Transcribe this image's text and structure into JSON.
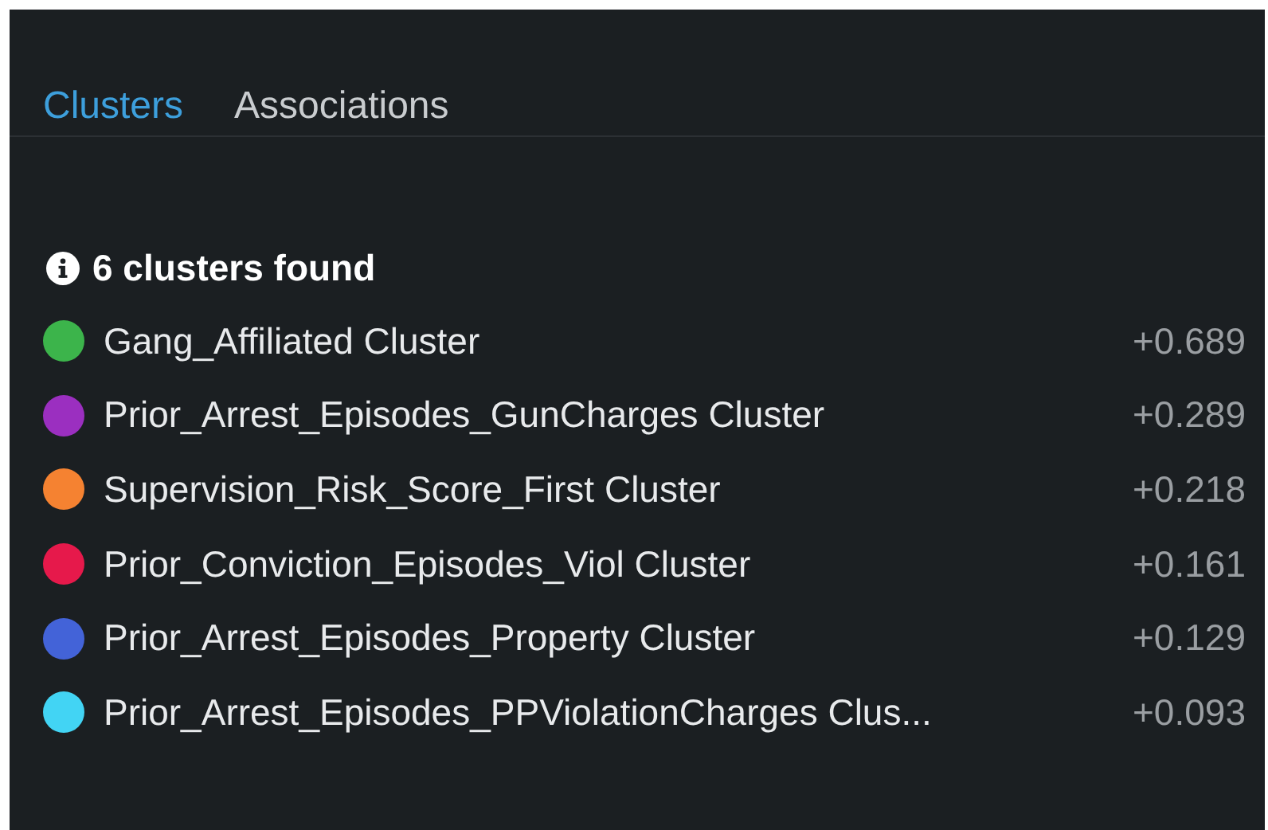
{
  "tabs": [
    {
      "label": "Clusters",
      "selected": true
    },
    {
      "label": "Associations",
      "selected": false
    }
  ],
  "summary": "6 clusters found",
  "clusters": [
    {
      "name": "Gang_Affiliated Cluster",
      "value": "+0.689",
      "color": "#3cb44b"
    },
    {
      "name": "Prior_Arrest_Episodes_GunCharges Cluster",
      "value": "+0.289",
      "color": "#9b2fc0"
    },
    {
      "name": "Supervision_Risk_Score_First Cluster",
      "value": "+0.218",
      "color": "#f58231"
    },
    {
      "name": "Prior_Conviction_Episodes_Viol Cluster",
      "value": "+0.161",
      "color": "#e6194b"
    },
    {
      "name": "Prior_Arrest_Episodes_Property Cluster",
      "value": "+0.129",
      "color": "#4363d8"
    },
    {
      "name": "Prior_Arrest_Episodes_PPViolationCharges Clus...",
      "value": "+0.093",
      "color": "#42d4f4"
    }
  ]
}
